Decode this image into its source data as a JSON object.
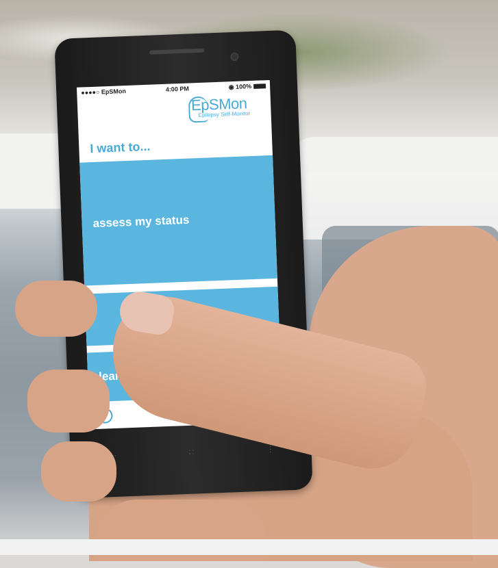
{
  "status_bar": {
    "carrier": "●●●●○ EpSMon",
    "time": "4:00 PM",
    "battery": "◉ 100%"
  },
  "app": {
    "logo_text": "EpSMon",
    "logo_subtitle": "Epilepsy Self-Monitor",
    "heading": "I want to...",
    "buttons": [
      {
        "label": "assess my status"
      },
      {
        "label": ""
      },
      {
        "label": "learn abou"
      }
    ],
    "info_icon": "i"
  },
  "nav_keys": [
    "···",
    "∷",
    "⋮"
  ],
  "colors": {
    "accent": "#5ab6df",
    "logo": "#4aaad6"
  }
}
